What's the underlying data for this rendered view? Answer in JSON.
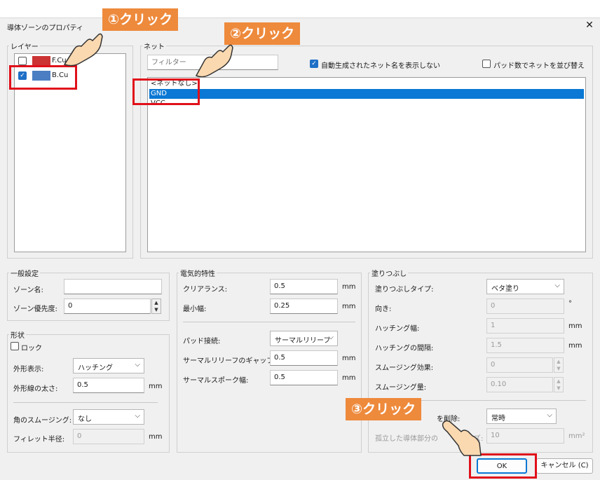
{
  "dialog": {
    "title": "導体ゾーンのプロパティ",
    "close_glyph": "✕"
  },
  "layers": {
    "legend": "レイヤー",
    "items": [
      {
        "label": "F.Cu",
        "checked": false,
        "color": "#cc3333"
      },
      {
        "label": "B.Cu",
        "checked": true,
        "color": "#4b7ec2"
      }
    ]
  },
  "nets": {
    "legend": "ネット",
    "filter_placeholder": "フィルター",
    "hide_auto_label": "自動生成されたネット名を表示しない",
    "hide_auto_checked": true,
    "sort_by_pads_label": "パッド数でネットを並び替え",
    "sort_by_pads_checked": false,
    "items": [
      "<ネットなし>",
      "GND",
      "VCC"
    ],
    "selected": "GND"
  },
  "general": {
    "legend": "一般設定",
    "zone_name_label": "ゾーン名:",
    "zone_name_value": "",
    "priority_label": "ゾーン優先度:",
    "priority_value": "0"
  },
  "shape": {
    "legend": "形状",
    "lock_label": "ロック",
    "outline_label": "外形表示:",
    "outline_value": "ハッチング",
    "outline_width_label": "外形線の太さ:",
    "outline_width_value": "0.5",
    "outline_width_unit": "mm",
    "corner_label": "角のスムージング:",
    "corner_value": "なし",
    "fillet_label": "フィレット半径:",
    "fillet_value": "0",
    "fillet_unit": "mm"
  },
  "electrical": {
    "legend": "電気的特性",
    "clearance_label": "クリアランス:",
    "clearance_value": "0.5",
    "clearance_unit": "mm",
    "min_width_label": "最小幅:",
    "min_width_value": "0.25",
    "min_width_unit": "mm",
    "pad_conn_label": "パッド接続:",
    "pad_conn_value": "サーマルリリーフ",
    "thermal_gap_label": "サーマルリリーフのギャップ:",
    "thermal_gap_value": "0.5",
    "thermal_gap_unit": "mm",
    "spoke_label": "サーマルスポーク幅:",
    "spoke_value": "0.5",
    "spoke_unit": "mm"
  },
  "fill": {
    "legend": "塗りつぶし",
    "type_label": "塗りつぶしタイプ:",
    "type_value": "ベタ塗り",
    "orient_label": "向き:",
    "orient_value": "0",
    "orient_unit": "°",
    "hatch_width_label": "ハッチング幅:",
    "hatch_width_value": "1",
    "hatch_width_unit": "mm",
    "hatch_gap_label": "ハッチングの間隔:",
    "hatch_gap_value": "1.5",
    "hatch_gap_unit": "mm",
    "smooth_effect_label": "スムージング効果:",
    "smooth_effect_value": "0",
    "smooth_amount_label": "スムージング量:",
    "smooth_amount_value": "0.10",
    "remove_islands_label": "を削除:",
    "remove_islands_value": "常時",
    "island_size_label": "孤立した導体部分の",
    "island_size_label_tail": "ズ:",
    "island_size_value": "10",
    "island_size_unit": "mm²"
  },
  "buttons": {
    "ok": "OK",
    "cancel": "キャンセル (C)"
  },
  "annotations": {
    "step1": "①クリック",
    "step2": "②クリック",
    "step3": "③クリック",
    "highlight_color": "#e0101a",
    "callout_color": "#ee8a3c"
  }
}
